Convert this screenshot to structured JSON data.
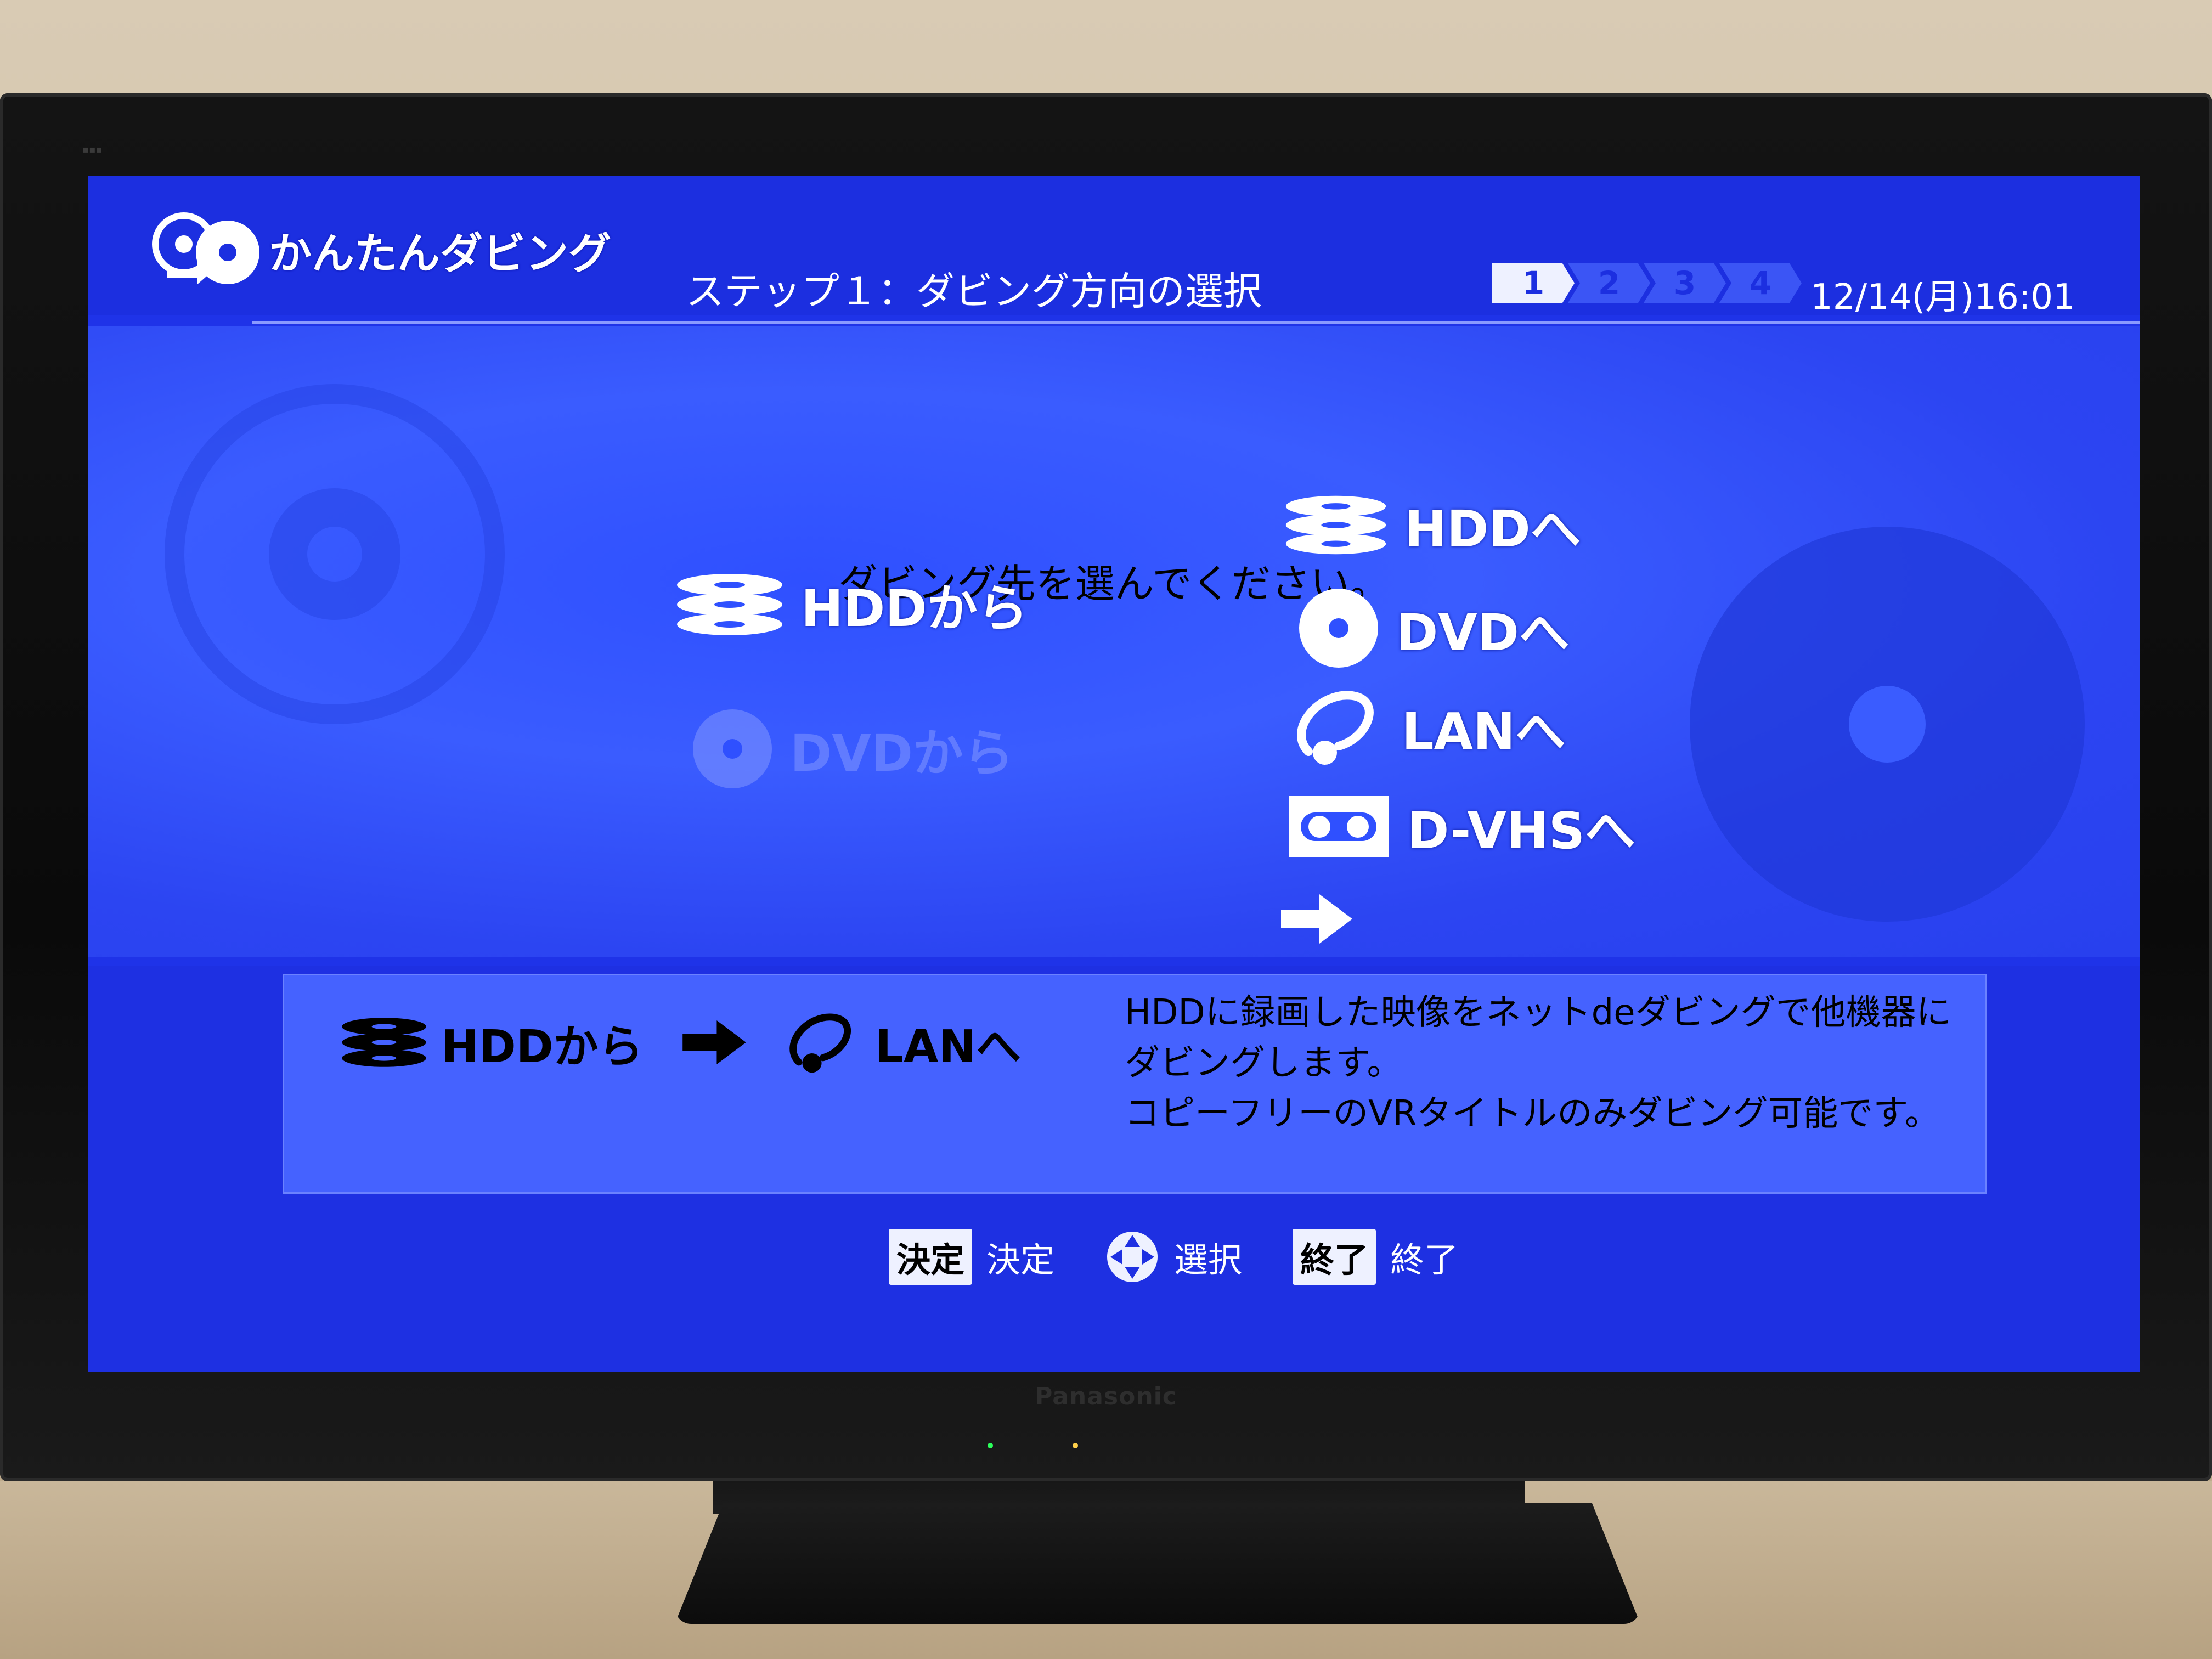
{
  "tv": {
    "brand": "Panasonic"
  },
  "header": {
    "app_title": "かんたんダビング",
    "step_title": "ステップ１：ダビング方向の選択",
    "steps": [
      "1",
      "2",
      "3",
      "4"
    ],
    "active_step": 1,
    "clock": "12/14(月)16:01"
  },
  "prompt": "ダビング先を選んでください。",
  "sources": [
    {
      "label": "HDDから",
      "icon": "hdd-icon",
      "enabled": true
    },
    {
      "label": "DVDから",
      "icon": "dvd-icon",
      "enabled": false
    }
  ],
  "destinations": [
    {
      "label": "HDDへ",
      "icon": "hdd-icon"
    },
    {
      "label": "DVDへ",
      "icon": "dvd-icon"
    },
    {
      "label": "LANへ",
      "icon": "lan-icon",
      "selected": true
    },
    {
      "label": "D-VHSへ",
      "icon": "vhs-icon"
    }
  ],
  "info": {
    "from": "HDDから",
    "to": "LANへ",
    "description": [
      "HDDに録画した映像をネットdeダビングで他機器に",
      "ダビングします。",
      "コピーフリーのVRタイトルのみダビング可能です。"
    ]
  },
  "guide": {
    "enter_key": "決定",
    "enter_label": "決定",
    "select_label": "選択",
    "exit_key": "終了",
    "exit_label": "終了"
  },
  "colors": {
    "screen_bg": "#1f33e8",
    "panel_bg": "#3a5cff",
    "text": "#ffffff",
    "step_active": "#eef1ff",
    "step_inactive": "#3b55f5"
  }
}
